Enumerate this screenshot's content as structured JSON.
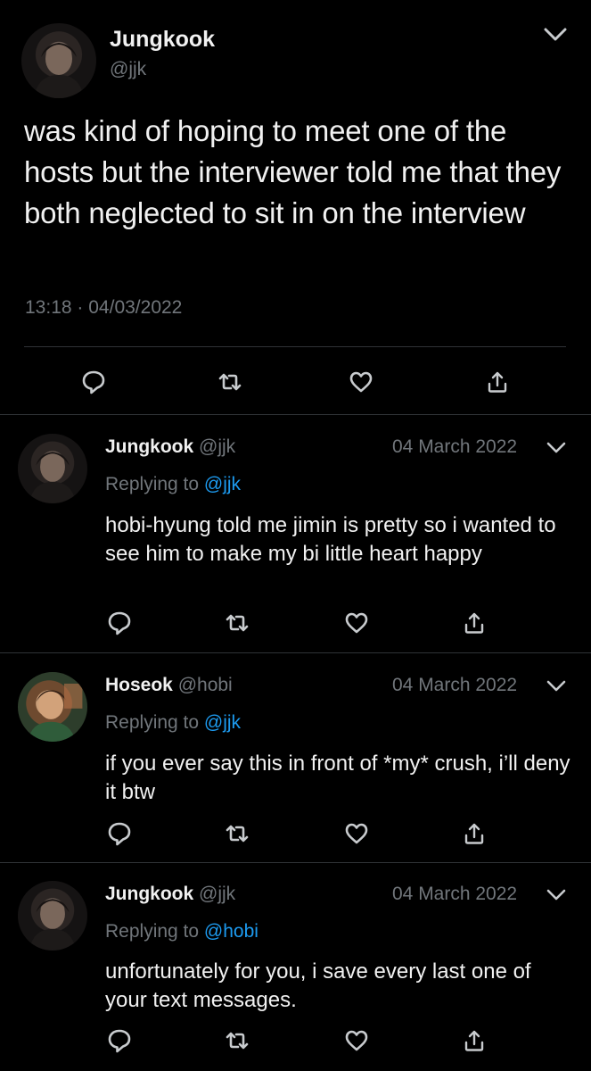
{
  "main_tweet": {
    "author_name": "Jungkook",
    "author_handle": "@jjk",
    "text": "was kind of hoping to meet one of the hosts but the interviewer told me that they both neglected to sit in on the interview",
    "time": "13:18",
    "separator": "·",
    "date": "04/03/2022"
  },
  "replies": [
    {
      "author_name": "Jungkook",
      "author_handle": "@jjk",
      "date": "04 March 2022",
      "replying_prefix": "Replying to",
      "replying_to": "@jjk",
      "text": "hobi-hyung told me jimin is pretty so i wanted to see him to make my bi little heart happy"
    },
    {
      "author_name": "Hoseok",
      "author_handle": "@hobi",
      "date": "04 March 2022",
      "replying_prefix": "Replying to",
      "replying_to": "@jjk",
      "text": "if you ever say this in front of *my* crush, i’ll deny it btw"
    },
    {
      "author_name": "Jungkook",
      "author_handle": "@jjk",
      "date": "04 March 2022",
      "replying_prefix": "Replying to",
      "replying_to": "@hobi",
      "text": "unfortunately for you, i save every last one of your text messages."
    }
  ],
  "icons": {
    "reply": "reply-icon",
    "retweet": "retweet-icon",
    "like": "heart-icon",
    "share": "share-icon",
    "more": "chevron-down-icon"
  },
  "colors": {
    "background": "#000000",
    "text": "#f1f1f1",
    "secondary_text": "#71767b",
    "mention": "#1d9bf0",
    "divider": "#2f3336",
    "icon": "#c8cbce"
  }
}
